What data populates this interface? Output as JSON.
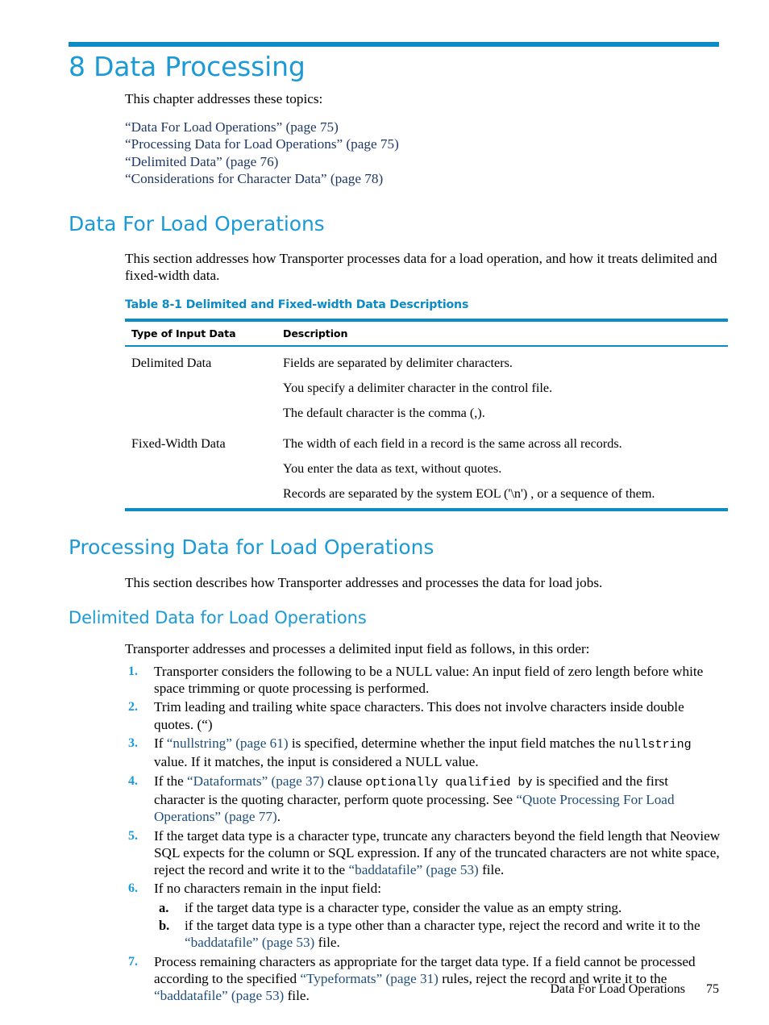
{
  "page": {
    "chapter_title": "8 Data Processing",
    "footer_section": "Data For Load Operations",
    "footer_page_number": "75",
    "accent_blue": "#1b9ad6",
    "rule_blue": "#0d8bc4",
    "xref_blue": "#1f4e79",
    "topic_link_blue": "#1f3864"
  },
  "intro": {
    "lead": "This chapter addresses these topics:",
    "topics": [
      "“Data For Load Operations” (page 75)",
      "“Processing Data for Load Operations” (page 75)",
      "“Delimited Data” (page 76)",
      "“Considerations for Character Data” (page 78)"
    ]
  },
  "section_data_for_load": {
    "heading": "Data For Load Operations",
    "paragraph": "This section addresses how Transporter processes data for a load operation, and how it treats delimited and fixed-width data.",
    "table": {
      "caption": "Table 8-1 Delimited and Fixed-width Data Descriptions",
      "columns": [
        "Type of Input Data",
        "Description"
      ],
      "rows": [
        {
          "type": "Delimited Data",
          "description": [
            "Fields are separated by delimiter characters.",
            "You specify a delimiter character in the control file.",
            "The default character is the comma (,)."
          ]
        },
        {
          "type": "Fixed-Width Data",
          "description": [
            "The width of each field in a record is the same across all records.",
            "You enter the data as text, without quotes.",
            "Records are separated by the system EOL ('\\n') , or a sequence of them."
          ]
        }
      ]
    }
  },
  "section_processing": {
    "heading": "Processing Data for Load Operations",
    "paragraph": "This section describes how Transporter addresses and processes the data for load jobs.",
    "subsection": {
      "heading": "Delimited Data for Load Operations",
      "paragraph": "Transporter addresses and processes a delimited input field as follows, in this order:",
      "steps": [
        {
          "num": "1.",
          "text": "Transporter considers the following to be a NULL value: An input field of zero length before white space trimming or quote processing is performed."
        },
        {
          "num": "2.",
          "text": "Trim leading and trailing white space characters. This does not involve characters inside double quotes. (“)"
        },
        {
          "num": "3.",
          "parts": [
            {
              "t": "If ",
              "k": "plain"
            },
            {
              "t": "“nullstring” (page 61)",
              "k": "xref"
            },
            {
              "t": " is specified, determine whether the input field matches the ",
              "k": "plain"
            },
            {
              "t": "nullstring",
              "k": "mono"
            },
            {
              "t": " value. If it matches, the input is considered a NULL value.",
              "k": "plain"
            }
          ]
        },
        {
          "num": "4.",
          "parts": [
            {
              "t": "If the ",
              "k": "plain"
            },
            {
              "t": "“Dataformats” (page 37)",
              "k": "xref"
            },
            {
              "t": " clause ",
              "k": "plain"
            },
            {
              "t": "optionally qualified by",
              "k": "mono"
            },
            {
              "t": " is specified and the first character is the quoting character, perform quote processing. See ",
              "k": "plain"
            },
            {
              "t": "“Quote Processing For Load Operations” (page 77)",
              "k": "xref"
            },
            {
              "t": ".",
              "k": "plain"
            }
          ]
        },
        {
          "num": "5.",
          "parts": [
            {
              "t": "If the target data type is a character type, truncate any characters beyond the field length that Neoview SQL expects for the column or SQL expression. If any of the truncated characters are not white space, reject the record and write it to the ",
              "k": "plain"
            },
            {
              "t": "“baddatafile” (page 53)",
              "k": "xref"
            },
            {
              "t": " file.",
              "k": "plain"
            }
          ]
        },
        {
          "num": "6.",
          "text": "If no characters remain in the input field:",
          "substeps": [
            {
              "num": "a.",
              "parts": [
                {
                  "t": "if the target data type is a character type, consider the value as an empty string.",
                  "k": "plain"
                }
              ]
            },
            {
              "num": "b.",
              "parts": [
                {
                  "t": "if the target data type is a type other than a character type, reject the record and write it to the ",
                  "k": "plain"
                },
                {
                  "t": "“baddatafile” (page 53)",
                  "k": "xref"
                },
                {
                  "t": " file.",
                  "k": "plain"
                }
              ]
            }
          ]
        },
        {
          "num": "7.",
          "parts": [
            {
              "t": "Process remaining characters as appropriate for the target data type. If a field cannot be processed according to the specified ",
              "k": "plain"
            },
            {
              "t": "“Typeformats” (page 31)",
              "k": "xref"
            },
            {
              "t": " rules, reject the record and write it to the ",
              "k": "plain"
            },
            {
              "t": "“baddatafile” (page 53)",
              "k": "xref"
            },
            {
              "t": " file.",
              "k": "plain"
            }
          ]
        }
      ]
    }
  }
}
